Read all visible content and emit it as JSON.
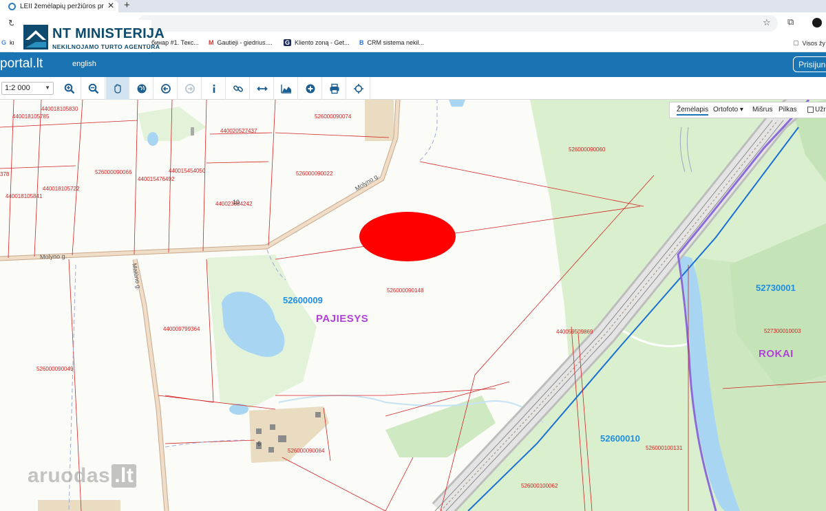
{
  "browser": {
    "tab_title": "LEII žemėlapių peržiūros prog",
    "tab_close": "✕",
    "new_tab": "+"
  },
  "bookmarks": [
    {
      "icon": "G",
      "label": "kn"
    },
    {
      "icon": "",
      "label": "бинар #1. Текс..."
    },
    {
      "icon": "M",
      "label": "Gautieji - giedrius...."
    },
    {
      "icon": "G",
      "label": "Kliento zoną - Get..."
    },
    {
      "icon": "B",
      "label": "CRM sistema nekil..."
    },
    {
      "icon": "▢",
      "label": "Visos žy"
    }
  ],
  "logo": {
    "name": "NT MINISTERIJA",
    "subtitle": "NEKILNOJAMO TURTO AGENTŪRA"
  },
  "portal": {
    "brand": "portal.lt",
    "language": "english",
    "login": "Prisijung"
  },
  "toolbar": {
    "scale": "1:2 000"
  },
  "map": {
    "layers": [
      "Žemėlapis",
      "Ortofoto ▾",
      "Mišrus",
      "Pilkas",
      "Užra"
    ],
    "parcels": [
      "440018105830",
      "440018105785",
      "440020527437",
      "526000090074",
      "526000090060",
      "378",
      "526000090066",
      "440015454050",
      "440015476492",
      "526000090022",
      "440018105722",
      "440018105841",
      "440023684242",
      "526000090148",
      "440009799364",
      "440059509869",
      "527300010003",
      "526000090049",
      "526000090064",
      "526000100131",
      "526000100062"
    ],
    "streets": [
      "Molyno g.",
      "Molyno g.",
      "Malūno g."
    ],
    "house_numbers": [
      "10",
      "6"
    ],
    "cadastral_blocks": [
      "52600009",
      "52730001",
      "52600010"
    ],
    "places": [
      "PAJIESYS",
      "ROKAI"
    ]
  },
  "watermark": {
    "text": "aruodas",
    "suffix": ".lt"
  },
  "colors": {
    "header_blue": "#1a73b2",
    "parcel_red": "#d42020",
    "cadastral_blue": "#1f8ee6",
    "place_purple": "#b040d8",
    "forest_green": "#d9efce",
    "water": "#a8d6f2",
    "marker_red": "#ff0000"
  }
}
